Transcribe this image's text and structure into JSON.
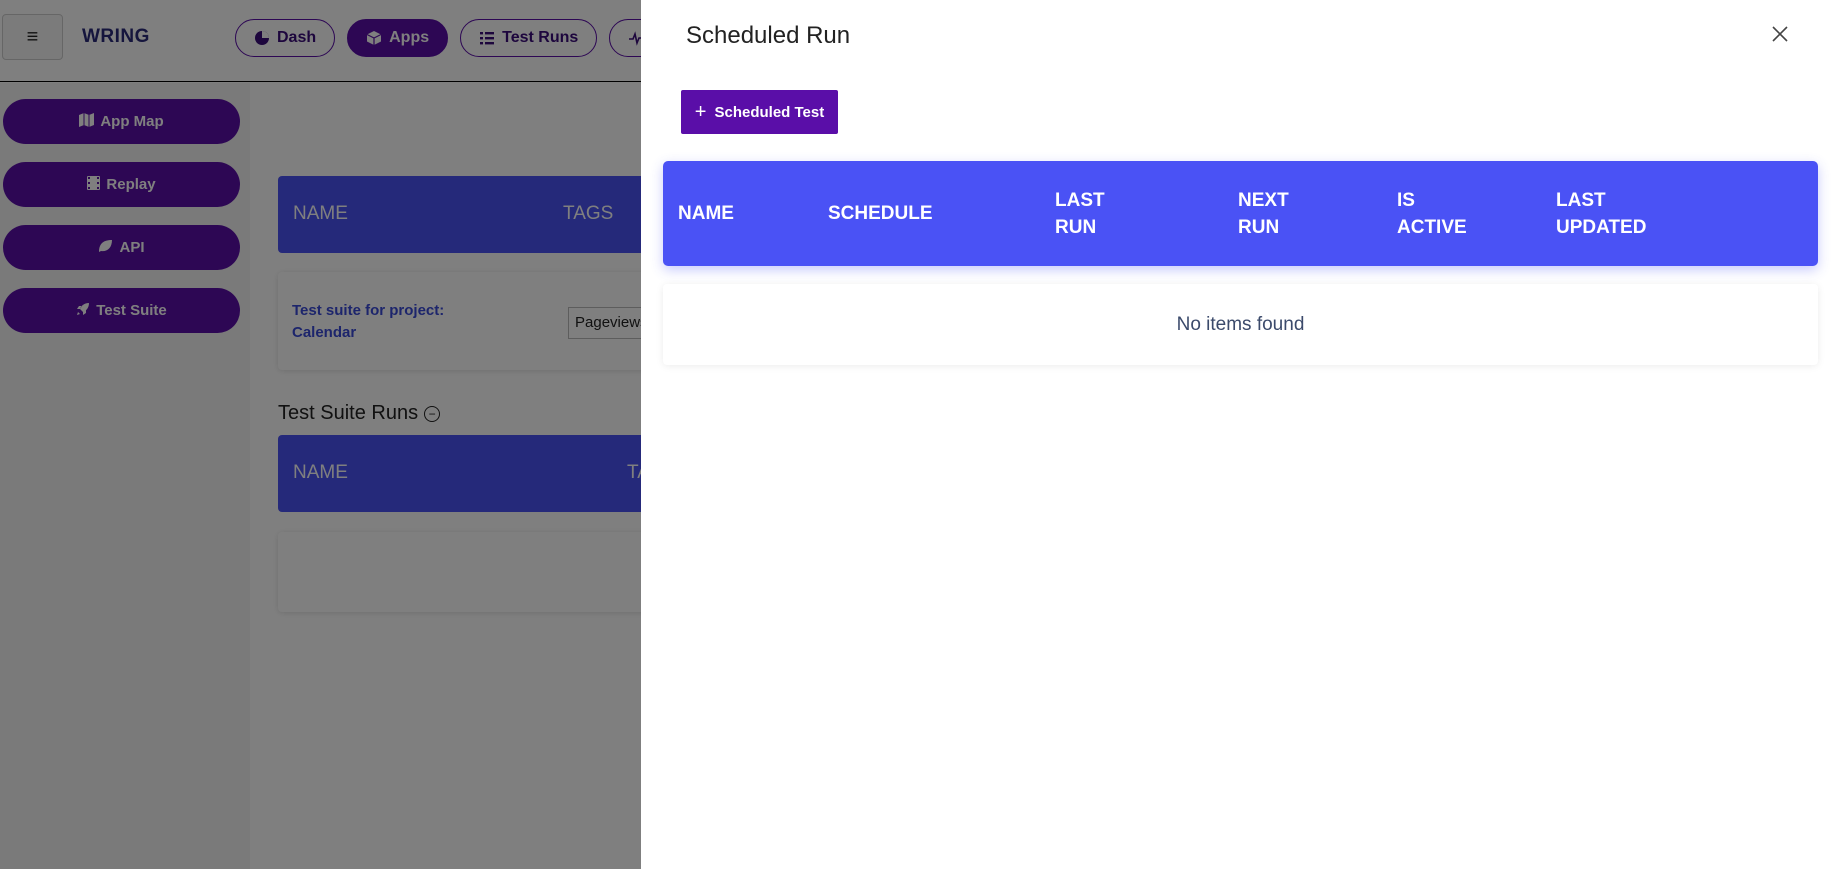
{
  "header": {
    "brand": "WRING",
    "nav": [
      {
        "label": "Dash",
        "icon": "pie-chart-icon"
      },
      {
        "label": "Apps",
        "icon": "cube-icon",
        "active": true
      },
      {
        "label": "Test Runs",
        "icon": "list-icon"
      },
      {
        "label": "",
        "icon": "activity-icon"
      }
    ]
  },
  "sidebar": {
    "items": [
      {
        "label": "App Map",
        "icon": "map-icon"
      },
      {
        "label": "Replay",
        "icon": "film-icon"
      },
      {
        "label": "API",
        "icon": "leaf-icon"
      },
      {
        "label": "Test Suite",
        "icon": "rocket-icon"
      }
    ]
  },
  "background": {
    "table_headers": [
      "NAME",
      "TAGS"
    ],
    "suite_text_line1": "Test suite for project:",
    "suite_text_line2": "Calendar",
    "select_value": "Pageviews",
    "section_title": "Test Suite Runs",
    "runs_headers": [
      "NAME",
      "TA"
    ]
  },
  "drawer": {
    "title": "Scheduled Run",
    "add_button_label": "Scheduled Test",
    "columns": {
      "name": "NAME",
      "schedule": "SCHEDULE",
      "last_run": "LAST RUN",
      "next_run": "NEXT RUN",
      "is_active": "IS ACTIVE",
      "last_updated": "LAST UPDATED"
    },
    "empty_message": "No items found"
  },
  "colors": {
    "primary": "#5a0ea8",
    "table_header": "#4a52f5"
  }
}
